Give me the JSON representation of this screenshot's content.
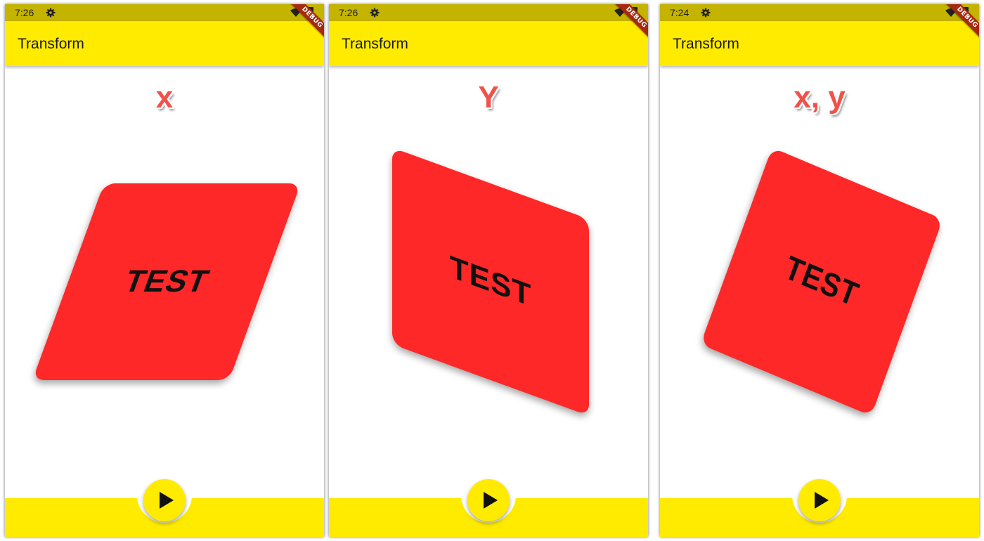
{
  "colors": {
    "status_bar": "#c4b400",
    "app_bar": "#ffeb00",
    "card": "#fe2828",
    "label": "#f0524a",
    "debug_banner": "#a52a0f"
  },
  "screens": [
    {
      "status": {
        "time": "7:26"
      },
      "app_bar": {
        "title": "Transform"
      },
      "debug_banner": "DEBUG",
      "label": "x",
      "card_text": "TEST",
      "fab_icon": "play-icon"
    },
    {
      "status": {
        "time": "7:26"
      },
      "app_bar": {
        "title": "Transform"
      },
      "debug_banner": "DEBUG",
      "label": "Y",
      "card_text": "TEST",
      "fab_icon": "play-icon"
    },
    {
      "status": {
        "time": "7:24"
      },
      "app_bar": {
        "title": "Transform"
      },
      "debug_banner": "DEBUG",
      "label": "x, y",
      "card_text": "TEST",
      "fab_icon": "play-icon"
    }
  ]
}
